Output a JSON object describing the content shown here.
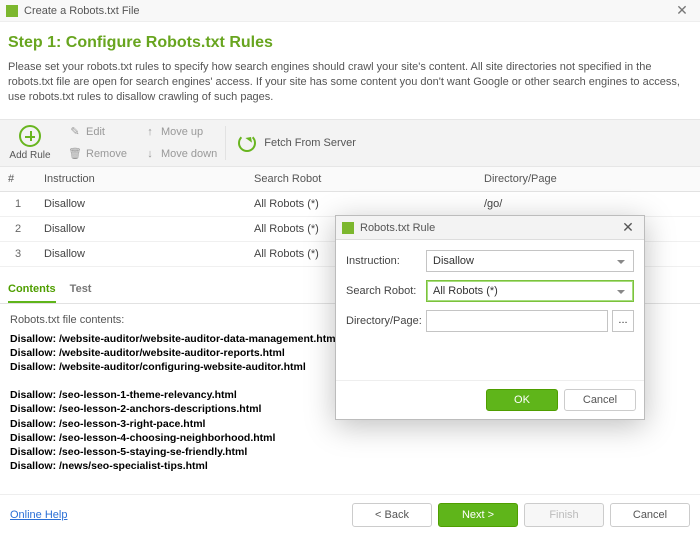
{
  "window": {
    "title": "Create a Robots.txt File",
    "close_glyph": "✕"
  },
  "step": {
    "heading": "Step 1: Configure Robots.txt Rules",
    "description": "Please set your robots.txt rules to specify how search engines should crawl your site's content. All site directories not specified in the robots.txt file are open for search engines' access. If your site has some content you don't want Google or other search engines to access, use robots.txt rules to disallow crawling of such pages."
  },
  "toolbar": {
    "add_rule": "Add Rule",
    "edit": "Edit",
    "remove": "Remove",
    "move_up": "Move up",
    "move_down": "Move down",
    "fetch": "Fetch From Server"
  },
  "table": {
    "headers": {
      "num": "#",
      "instruction": "Instruction",
      "robot": "Search Robot",
      "dir": "Directory/Page"
    },
    "rows": [
      {
        "num": "1",
        "instruction": "Disallow",
        "robot": "All Robots (*)",
        "dir": "/go/"
      },
      {
        "num": "2",
        "instruction": "Disallow",
        "robot": "All Robots (*)",
        "dir": ""
      },
      {
        "num": "3",
        "instruction": "Disallow",
        "robot": "All Robots (*)",
        "dir": ""
      }
    ]
  },
  "tabs": {
    "contents": "Contents",
    "test": "Test"
  },
  "contents": {
    "caption": "Robots.txt file contents:",
    "lines": [
      "Disallow: /website-auditor/website-auditor-data-management.html",
      "Disallow: /website-auditor/website-auditor-reports.html",
      "Disallow: /website-auditor/configuring-website-auditor.html",
      "",
      "Disallow: /seo-lesson-1-theme-relevancy.html",
      "Disallow: /seo-lesson-2-anchors-descriptions.html",
      "Disallow: /seo-lesson-3-right-pace.html",
      "Disallow: /seo-lesson-4-choosing-neighborhood.html",
      "Disallow: /seo-lesson-5-staying-se-friendly.html",
      "Disallow: /news/seo-specialist-tips.html"
    ]
  },
  "footer": {
    "help": "Online Help",
    "back": "< Back",
    "next": "Next >",
    "finish": "Finish",
    "cancel": "Cancel"
  },
  "modal": {
    "title": "Robots.txt Rule",
    "instruction_label": "Instruction:",
    "instruction_value": "Disallow",
    "robot_label": "Search Robot:",
    "robot_value": "All Robots (*)",
    "dir_label": "Directory/Page:",
    "dir_value": "",
    "browse": "...",
    "ok": "OK",
    "cancel": "Cancel"
  }
}
